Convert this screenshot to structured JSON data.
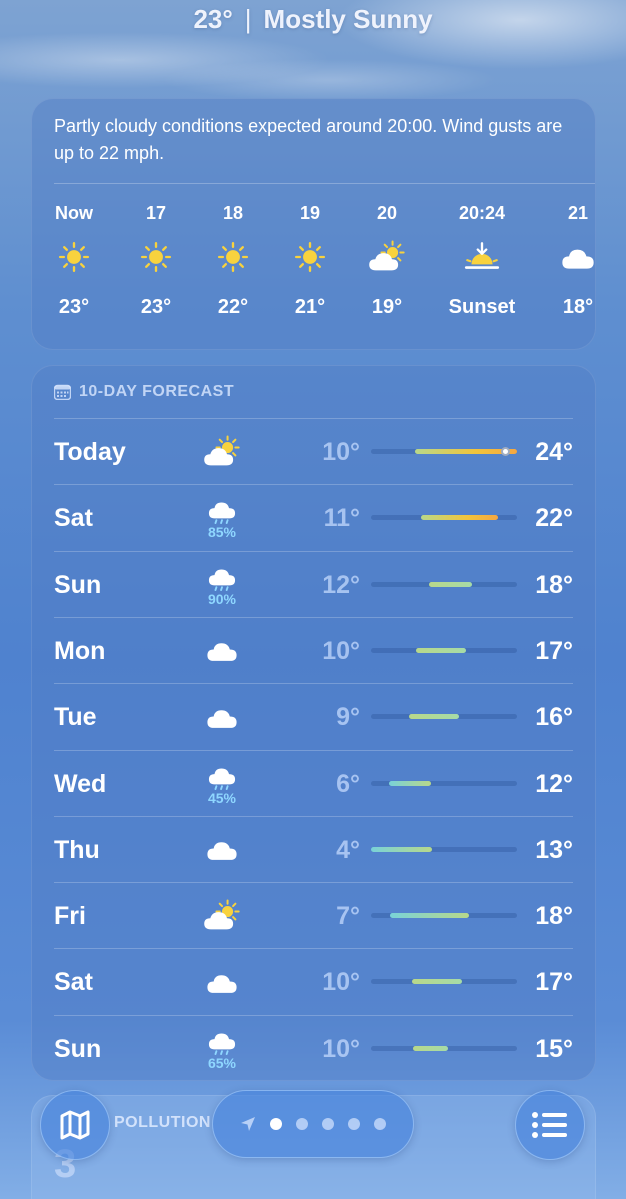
{
  "header": {
    "temp": "23°",
    "separator": "|",
    "condition": "Mostly Sunny"
  },
  "hourly": {
    "summary": "Partly cloudy conditions expected around 20:00. Wind gusts are up to 22 mph.",
    "items": [
      {
        "time": "Now",
        "icon": "sun-icon",
        "temp": "23°"
      },
      {
        "time": "17",
        "icon": "sun-icon",
        "temp": "23°"
      },
      {
        "time": "18",
        "icon": "sun-icon",
        "temp": "22°"
      },
      {
        "time": "19",
        "icon": "sun-icon",
        "temp": "21°"
      },
      {
        "time": "20",
        "icon": "partly-cloudy-icon",
        "temp": "19°"
      },
      {
        "time": "20:24",
        "icon": "sunset-icon",
        "temp": "Sunset"
      },
      {
        "time": "21",
        "icon": "cloud-icon",
        "temp": "18°"
      }
    ]
  },
  "forecast": {
    "title": "10-DAY FORECAST",
    "colors": {
      "track": "#3a5f9c",
      "warm": "#f2c43b",
      "mild": "#b8d88a",
      "cool": "#79d2d8"
    },
    "days": [
      {
        "day": "Today",
        "icon": "partly-cloudy-icon",
        "precip": "",
        "low": "10°",
        "high": "24°",
        "range_start": 0.3,
        "range_end": 1.0,
        "current_marker": 0.92
      },
      {
        "day": "Sat",
        "icon": "rain-icon",
        "precip": "85%",
        "low": "11°",
        "high": "22°",
        "range_start": 0.34,
        "range_end": 0.87
      },
      {
        "day": "Sun",
        "icon": "rain-icon",
        "precip": "90%",
        "low": "12°",
        "high": "18°",
        "range_start": 0.4,
        "range_end": 0.69
      },
      {
        "day": "Mon",
        "icon": "cloud-icon",
        "precip": "",
        "low": "10°",
        "high": "17°",
        "range_start": 0.31,
        "range_end": 0.65
      },
      {
        "day": "Tue",
        "icon": "cloud-icon",
        "precip": "",
        "low": "9°",
        "high": "16°",
        "range_start": 0.26,
        "range_end": 0.6
      },
      {
        "day": "Wed",
        "icon": "rain-icon",
        "precip": "45%",
        "low": "6°",
        "high": "12°",
        "range_start": 0.12,
        "range_end": 0.41
      },
      {
        "day": "Thu",
        "icon": "cloud-icon",
        "precip": "",
        "low": "4°",
        "high": "13°",
        "range_start": 0.0,
        "range_end": 0.42
      },
      {
        "day": "Fri",
        "icon": "partly-cloudy-icon",
        "precip": "",
        "low": "7°",
        "high": "18°",
        "range_start": 0.13,
        "range_end": 0.67
      },
      {
        "day": "Sat",
        "icon": "cloud-icon",
        "precip": "",
        "low": "10°",
        "high": "17°",
        "range_start": 0.28,
        "range_end": 0.62
      },
      {
        "day": "Sun",
        "icon": "rain-icon",
        "precip": "65%",
        "low": "10°",
        "high": "15°",
        "range_start": 0.29,
        "range_end": 0.53
      }
    ]
  },
  "pollution": {
    "label": "POLLUTION",
    "value": "3"
  },
  "toolbar": {
    "map_icon": "map-icon",
    "location_icon": "location-arrow-icon",
    "page_count": 5,
    "active_page": 0,
    "list_icon": "list-icon"
  }
}
